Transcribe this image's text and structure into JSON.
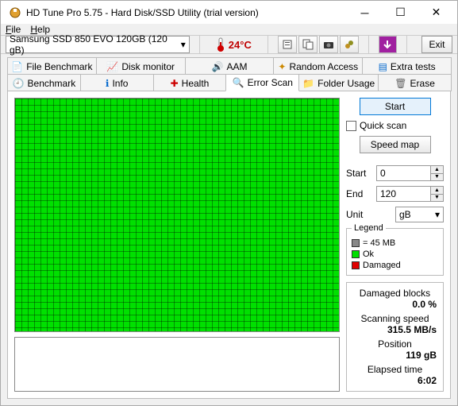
{
  "window": {
    "title": "HD Tune Pro 5.75 - Hard Disk/SSD Utility (trial version)"
  },
  "menu": {
    "file": "File",
    "help": "Help"
  },
  "toolbar": {
    "drive": "Samsung SSD 850 EVO 120GB (120 gB)",
    "temperature": "24°C",
    "exit": "Exit"
  },
  "tabs": {
    "row1": [
      {
        "label": "File Benchmark"
      },
      {
        "label": "Disk monitor"
      },
      {
        "label": "AAM"
      },
      {
        "label": "Random Access"
      },
      {
        "label": "Extra tests"
      }
    ],
    "row2": [
      {
        "label": "Benchmark"
      },
      {
        "label": "Info"
      },
      {
        "label": "Health"
      },
      {
        "label": "Error Scan"
      },
      {
        "label": "Folder Usage"
      },
      {
        "label": "Erase"
      }
    ]
  },
  "panel": {
    "start": "Start",
    "quick_scan": "Quick scan",
    "speed_map": "Speed map",
    "start_label": "Start",
    "start_value": "0",
    "end_label": "End",
    "end_value": "120",
    "unit_label": "Unit",
    "unit_value": "gB",
    "legend_title": "Legend",
    "legend_block": " = 45 MB",
    "legend_ok": "Ok",
    "legend_damaged": "Damaged",
    "damaged_blocks_label": "Damaged blocks",
    "damaged_blocks_value": "0.0 %",
    "scan_speed_label": "Scanning speed",
    "scan_speed_value": "315.5 MB/s",
    "position_label": "Position",
    "position_value": "119 gB",
    "elapsed_label": "Elapsed time",
    "elapsed_value": "6:02"
  }
}
